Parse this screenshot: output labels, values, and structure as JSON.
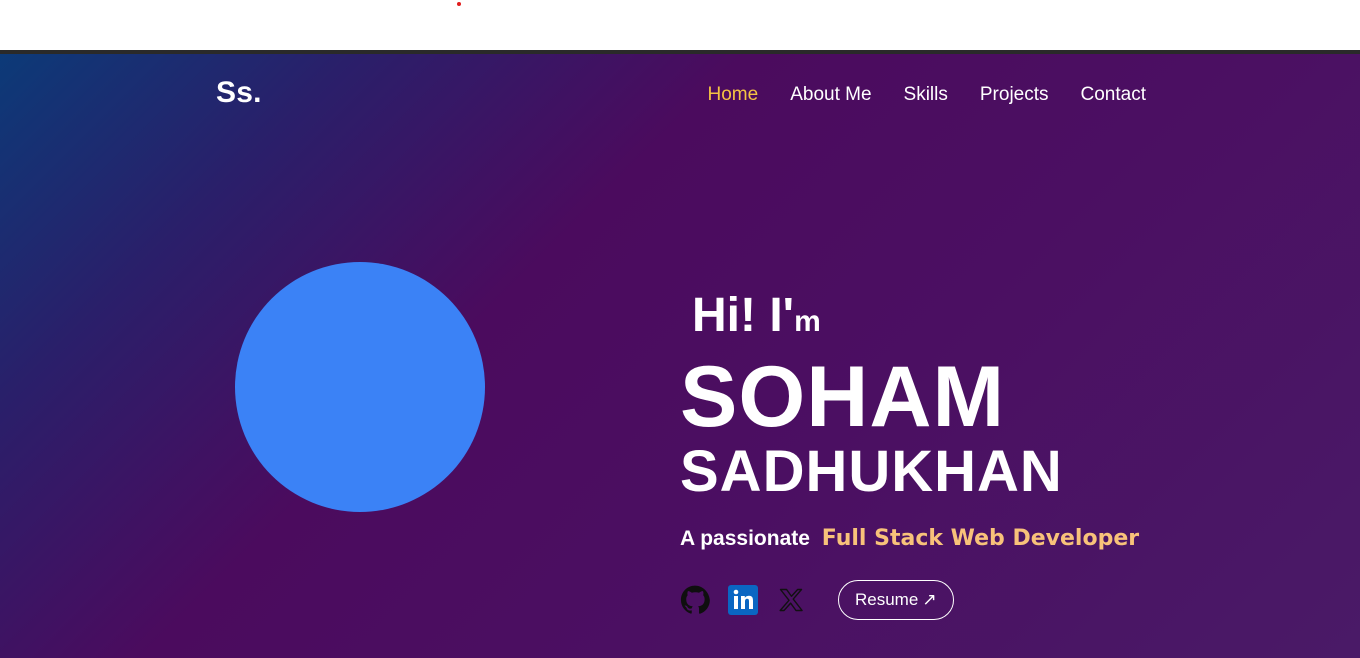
{
  "nav": {
    "logo": "Ss.",
    "items": [
      {
        "label": "Home",
        "active": true
      },
      {
        "label": "About Me",
        "active": false
      },
      {
        "label": "Skills",
        "active": false
      },
      {
        "label": "Projects",
        "active": false
      },
      {
        "label": "Contact",
        "active": false
      }
    ],
    "active_color": "#f5c343"
  },
  "hero": {
    "greeting": "Hi! I'",
    "greeting_suffix": "m",
    "first_name": "SOHAM",
    "last_name": "SADHUKHAN",
    "tagline_prefix": "A passionate",
    "tagline_role": "Full Stack Web Developer",
    "avatar_color": "#3b82f6",
    "role_color": "#f8c27a"
  },
  "socials": {
    "github_icon": "github-icon",
    "linkedin_icon": "linkedin-icon",
    "x_icon": "x-twitter-icon",
    "resume_label": "Resume",
    "resume_arrow": "↗"
  }
}
